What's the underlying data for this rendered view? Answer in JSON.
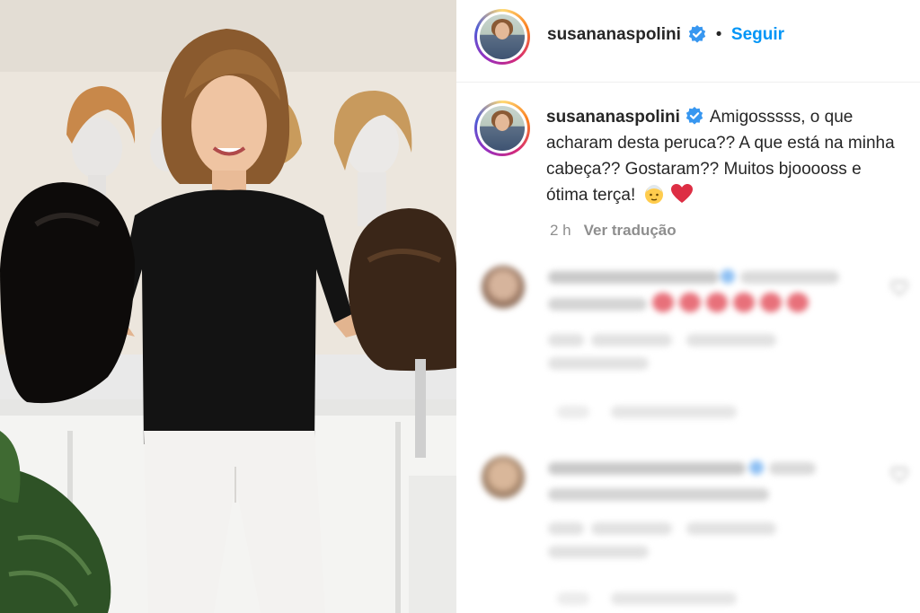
{
  "post": {
    "username": "susananaspolini",
    "follow_label": "Seguir",
    "separator": "•",
    "caption_text": "Amigosssss, o que acharam desta peruca?? A que está na minha cabeça?? Gostaram?? Muitos bjooooss e ótima terça!",
    "caption_emojis": [
      "older-person-emoji",
      "red-heart-emoji"
    ],
    "time_ago": "2 h",
    "translate_label": "Ver tradução"
  },
  "comments": [
    {
      "blurred": true,
      "icon": "heart-icon"
    },
    {
      "blurred": true,
      "icon": "heart-icon"
    }
  ],
  "colors": {
    "follow_blue": "#0095f6",
    "verified_blue": "#3897f0",
    "heart_red": "#ed4956",
    "secondary_text": "#8e8e8e"
  }
}
